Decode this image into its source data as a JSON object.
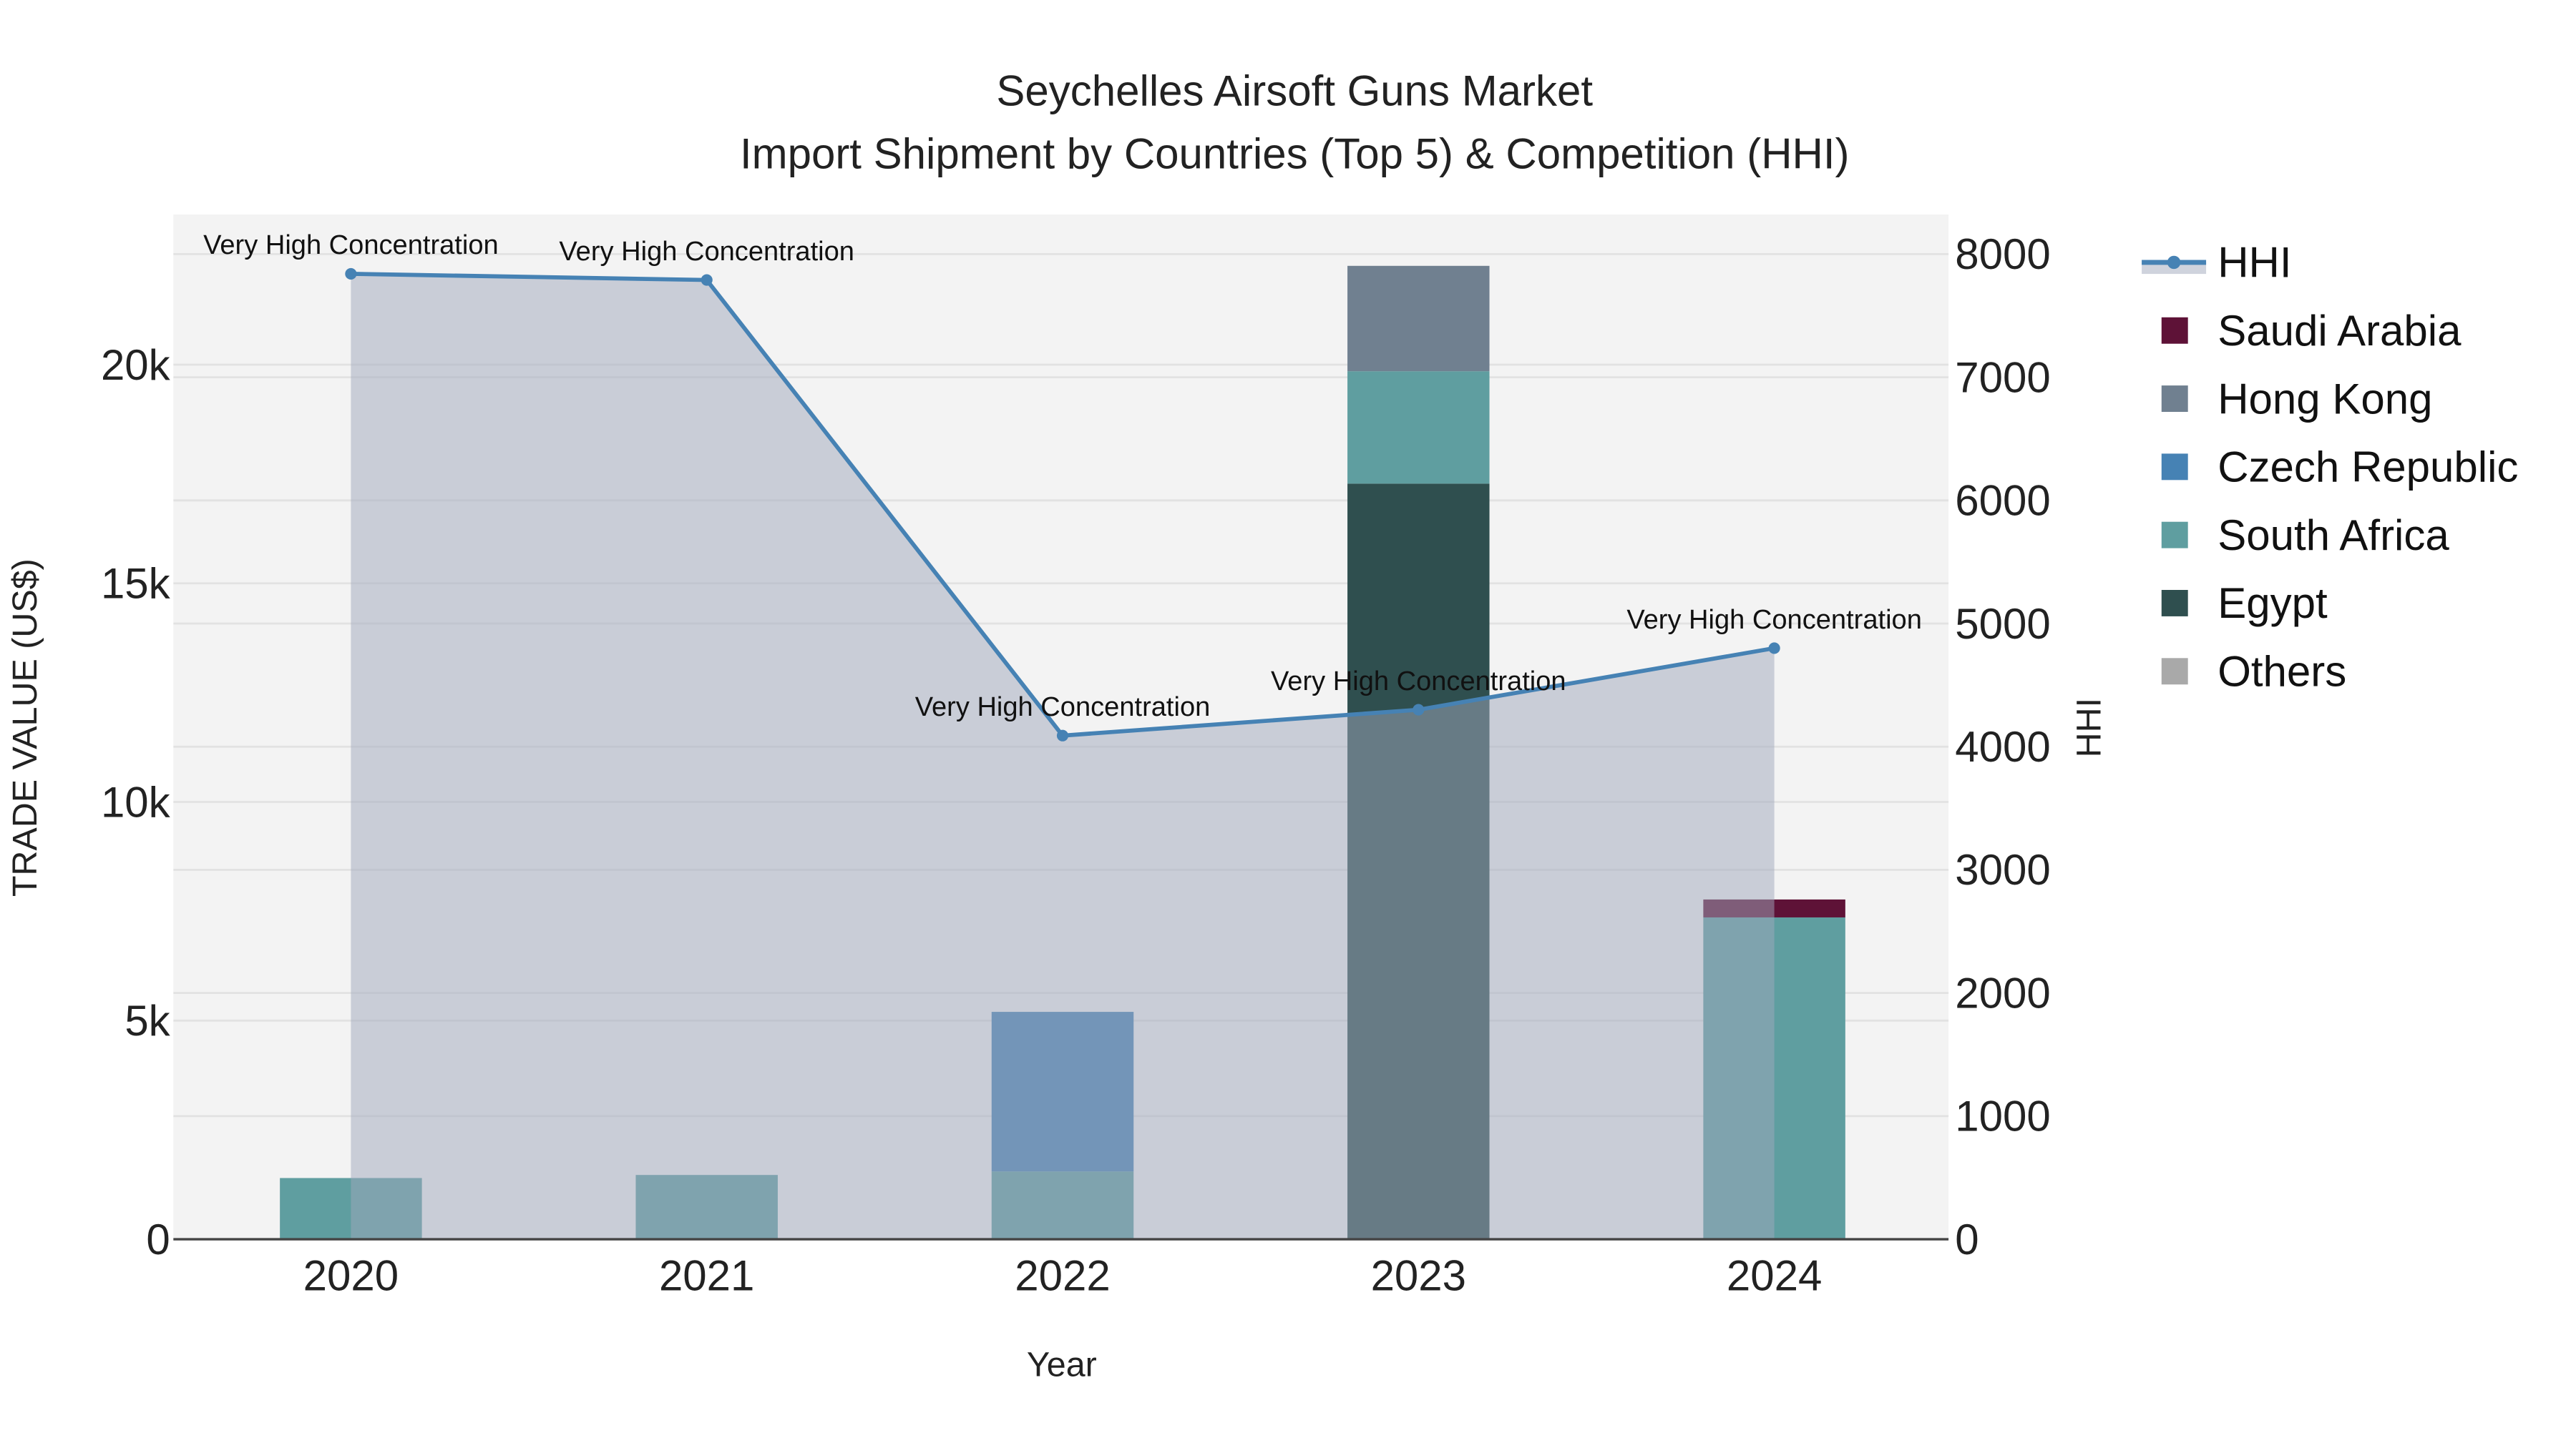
{
  "chart_data": {
    "type": "bar",
    "title_line1": "Seychelles Airsoft Guns Market",
    "title_line2": "Import Shipment by Countries (Top 5) & Competition (HHI)",
    "xlabel": "Year",
    "ylabel": "TRADE VALUE (US$)",
    "y2label": "HHI",
    "categories": [
      "2020",
      "2021",
      "2022",
      "2023",
      "2024"
    ],
    "ylim": [
      0,
      22800
    ],
    "y2lim": [
      0,
      8300
    ],
    "yticks": [
      0,
      5000,
      10000,
      15000,
      20000
    ],
    "ytick_labels": [
      "0",
      "5k",
      "10k",
      "15k",
      "20k"
    ],
    "y2ticks": [
      0,
      1000,
      2000,
      3000,
      4000,
      5000,
      6000,
      7000,
      8000
    ],
    "y2tick_labels": [
      "0",
      "1000",
      "2000",
      "3000",
      "4000",
      "5000",
      "6000",
      "7000",
      "8000"
    ],
    "grid": true,
    "legend_position": "right",
    "stack_order": [
      "Egypt",
      "South Africa",
      "Czech Republic",
      "Hong Kong",
      "Saudi Arabia",
      "Others"
    ],
    "series": [
      {
        "name": "Saudi Arabia",
        "color": "#5e1237",
        "values": [
          0,
          0,
          0,
          0,
          410
        ]
      },
      {
        "name": "Hong Kong",
        "color": "#708090",
        "values": [
          0,
          0,
          0,
          2410,
          0
        ]
      },
      {
        "name": "Czech Republic",
        "color": "#4682b4",
        "values": [
          0,
          0,
          3650,
          0,
          0
        ]
      },
      {
        "name": "South Africa",
        "color": "#5f9ea0",
        "values": [
          1400,
          1470,
          1550,
          2570,
          7360
        ]
      },
      {
        "name": "Egypt",
        "color": "#2f4f4f",
        "values": [
          0,
          0,
          0,
          17280,
          0
        ]
      },
      {
        "name": "Others",
        "color": "#a9a9a9",
        "values": [
          0,
          0,
          0,
          0,
          0
        ]
      }
    ],
    "hhi": {
      "name": "HHI",
      "color": "#4682b4",
      "fill": "#a0a8bc",
      "values": [
        7840,
        7790,
        4090,
        4300,
        4800
      ],
      "annotations": [
        "Very High Concentration",
        "Very High Concentration",
        "Very High Concentration",
        "Very High Concentration",
        "Very High Concentration"
      ]
    }
  }
}
